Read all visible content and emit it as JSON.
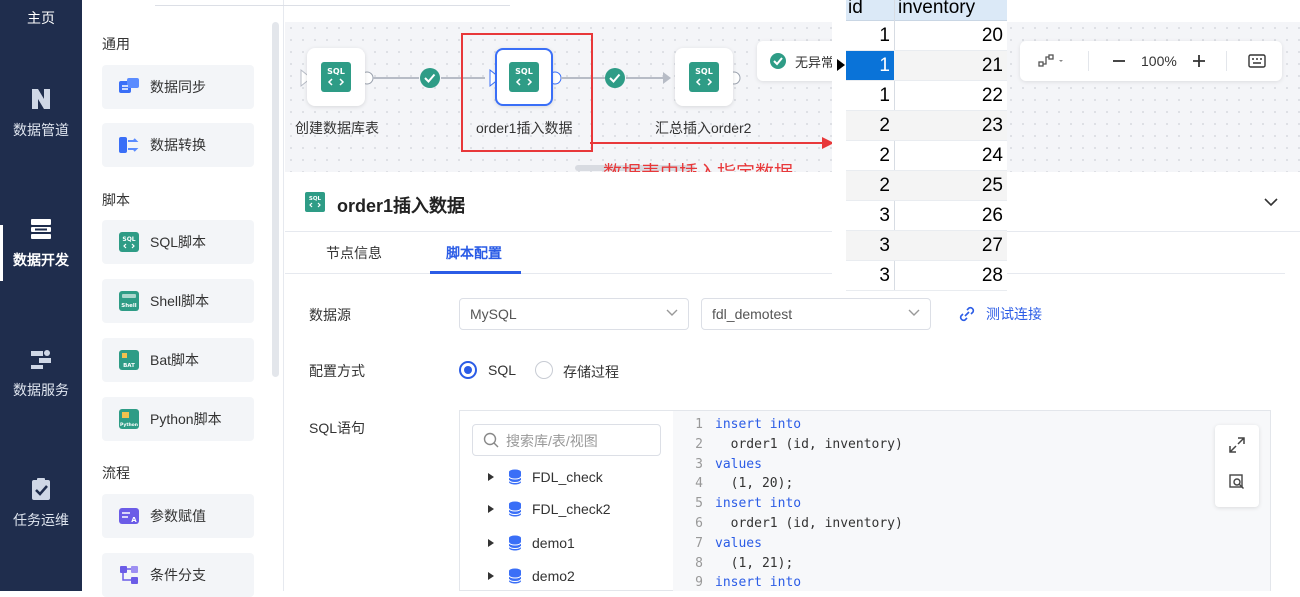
{
  "nav": {
    "home": "主页",
    "items": [
      {
        "label": "数据管道",
        "icon": "pipeline-icon"
      },
      {
        "label": "数据开发",
        "icon": "dev-icon"
      },
      {
        "label": "数据服务",
        "icon": "service-icon"
      },
      {
        "label": "任务运维",
        "icon": "task-icon"
      }
    ]
  },
  "palette": {
    "sections": [
      "通用",
      "脚本",
      "流程"
    ],
    "items": [
      {
        "label": "数据同步",
        "icon": "data-sync-icon"
      },
      {
        "label": "数据转换",
        "icon": "data-transform-icon"
      },
      {
        "label": "SQL脚本",
        "icon": "sql-script-icon"
      },
      {
        "label": "Shell脚本",
        "icon": "shell-script-icon"
      },
      {
        "label": "Bat脚本",
        "icon": "bat-script-icon"
      },
      {
        "label": "Python脚本",
        "icon": "python-script-icon"
      },
      {
        "label": "参数赋值",
        "icon": "param-assign-icon"
      },
      {
        "label": "条件分支",
        "icon": "condition-branch-icon"
      }
    ]
  },
  "canvas": {
    "nodes": [
      {
        "label": "创建数据库表",
        "badge": "SQL"
      },
      {
        "label": "order1插入数据",
        "badge": "SQL"
      },
      {
        "label": "汇总插入order2",
        "badge": "SQL"
      }
    ],
    "status": "无异常",
    "zoom": "100%",
    "annotation": "数据表中插入指定数据"
  },
  "detail": {
    "badge": "SQL",
    "title": "order1插入数据",
    "tabs": [
      "节点信息",
      "脚本配置"
    ],
    "active_tab": "脚本配置",
    "datasource_label": "数据源",
    "datasource_type": "MySQL",
    "datasource_db": "fdl_demotest",
    "test_connection": "测试连接",
    "config_label": "配置方式",
    "config_options": [
      "SQL",
      "存储过程"
    ],
    "sql_label": "SQL语句",
    "search_placeholder": "搜索库/表/视图",
    "tree": [
      "FDL_check",
      "FDL_check2",
      "demo1",
      "demo2"
    ]
  },
  "code_lines": [
    {
      "n": "1",
      "kw": "insert into",
      "rest": ""
    },
    {
      "n": "2",
      "kw": "",
      "rest": "  order1 (id, inventory)"
    },
    {
      "n": "3",
      "kw": "values",
      "rest": ""
    },
    {
      "n": "4",
      "kw": "",
      "rest": "  (1, 20);"
    },
    {
      "n": "5",
      "kw": "insert into",
      "rest": ""
    },
    {
      "n": "6",
      "kw": "",
      "rest": "  order1 (id, inventory)"
    },
    {
      "n": "7",
      "kw": "values",
      "rest": ""
    },
    {
      "n": "8",
      "kw": "",
      "rest": "  (1, 21);"
    },
    {
      "n": "9",
      "kw": "insert into",
      "rest": ""
    }
  ],
  "table": {
    "headers": [
      "id",
      "inventory"
    ],
    "rows": [
      [
        "1",
        "20"
      ],
      [
        "1",
        "21"
      ],
      [
        "1",
        "22"
      ],
      [
        "2",
        "23"
      ],
      [
        "2",
        "24"
      ],
      [
        "2",
        "25"
      ],
      [
        "3",
        "26"
      ],
      [
        "3",
        "27"
      ],
      [
        "3",
        "28"
      ]
    ],
    "selected_row": 1
  },
  "colors": {
    "nav_bg": "#1f2d4d",
    "accent": "#2b5ce6",
    "sql_green": "#2e9c86",
    "annotation_red": "#e8383a",
    "table_selected": "#0a73d8"
  }
}
